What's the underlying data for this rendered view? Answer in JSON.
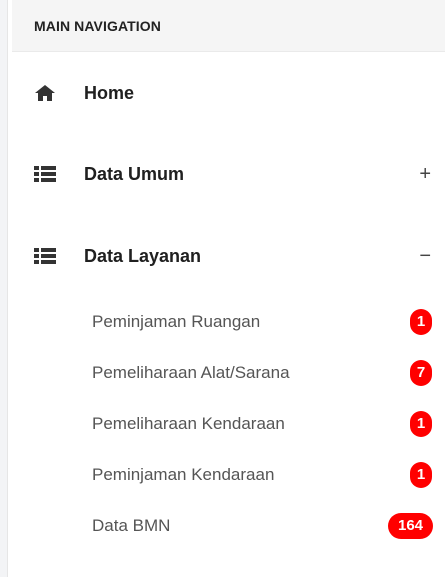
{
  "sidebar": {
    "header": "MAIN NAVIGATION",
    "items": [
      {
        "label": "Home",
        "icon": "home-icon"
      },
      {
        "label": "Data Umum",
        "icon": "list-icon",
        "toggle": "+"
      },
      {
        "label": "Data Layanan",
        "icon": "list-icon",
        "toggle": "−"
      }
    ],
    "submenu": [
      {
        "label": "Peminjaman Ruangan",
        "badge": "1"
      },
      {
        "label": "Pemeliharaan Alat/Sarana",
        "badge": "7"
      },
      {
        "label": "Pemeliharaan Kendaraan",
        "badge": "1"
      },
      {
        "label": "Peminjaman Kendaraan",
        "badge": "1"
      },
      {
        "label": "Data BMN",
        "badge": "164"
      }
    ]
  },
  "colors": {
    "badge": "#ff0000",
    "header_bg": "#f5f5f5",
    "text": "#202020",
    "sub_text": "#555555"
  }
}
